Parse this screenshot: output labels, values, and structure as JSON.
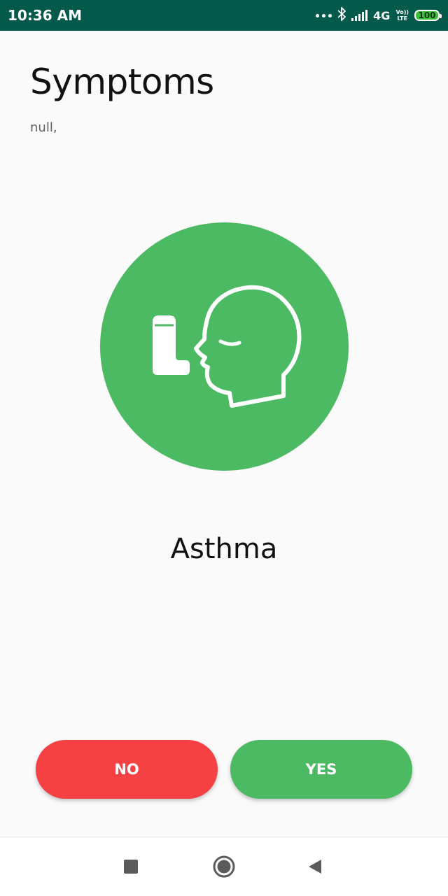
{
  "status_bar": {
    "time": "10:36 AM",
    "network": "4G",
    "volte_top": "Vo))",
    "volte_bottom": "LTE",
    "battery": "100",
    "icons": [
      "more-dots-icon",
      "bluetooth-icon",
      "signal-icon",
      "volte-icon",
      "battery-icon"
    ]
  },
  "header": {
    "title": "Symptoms",
    "subtitle": "null,"
  },
  "symptom": {
    "name": "Asthma",
    "icon": "inhaler-head-icon",
    "circle_color": "#4cb963"
  },
  "actions": {
    "no_label": "NO",
    "yes_label": "YES",
    "no_color": "#f64144",
    "yes_color": "#4cb963"
  },
  "nav_bar": {
    "icons": [
      "recents-square-icon",
      "home-circle-icon",
      "back-triangle-icon"
    ]
  }
}
